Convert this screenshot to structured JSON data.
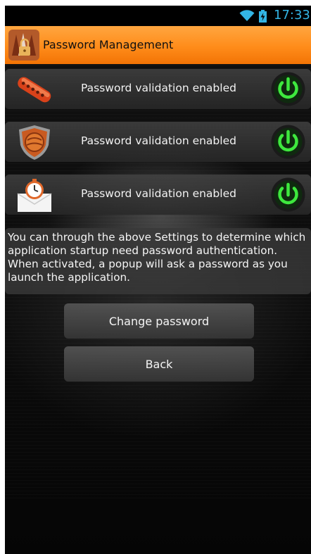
{
  "status_bar": {
    "time": "17:33",
    "icons": [
      "wifi-icon",
      "battery-charging-icon"
    ],
    "clock_color": "#33b5e5"
  },
  "header": {
    "title": "Password Management",
    "icon": "lock-app-icon",
    "color": "#ff8c1a"
  },
  "settings": [
    {
      "label": "Password validation enabled",
      "icon": "remote-control-icon",
      "enabled": true
    },
    {
      "label": "Password validation enabled",
      "icon": "shield-icon",
      "enabled": true
    },
    {
      "label": "Password validation enabled",
      "icon": "alarm-mail-icon",
      "enabled": true
    }
  ],
  "toggle_color": "#3ee83e",
  "info": {
    "text": "You can through the above Settings to determine which application startup need password authentication. When activated, a popup will ask a password as you launch the application."
  },
  "buttons": {
    "change_password": "Change password",
    "back": "Back"
  }
}
